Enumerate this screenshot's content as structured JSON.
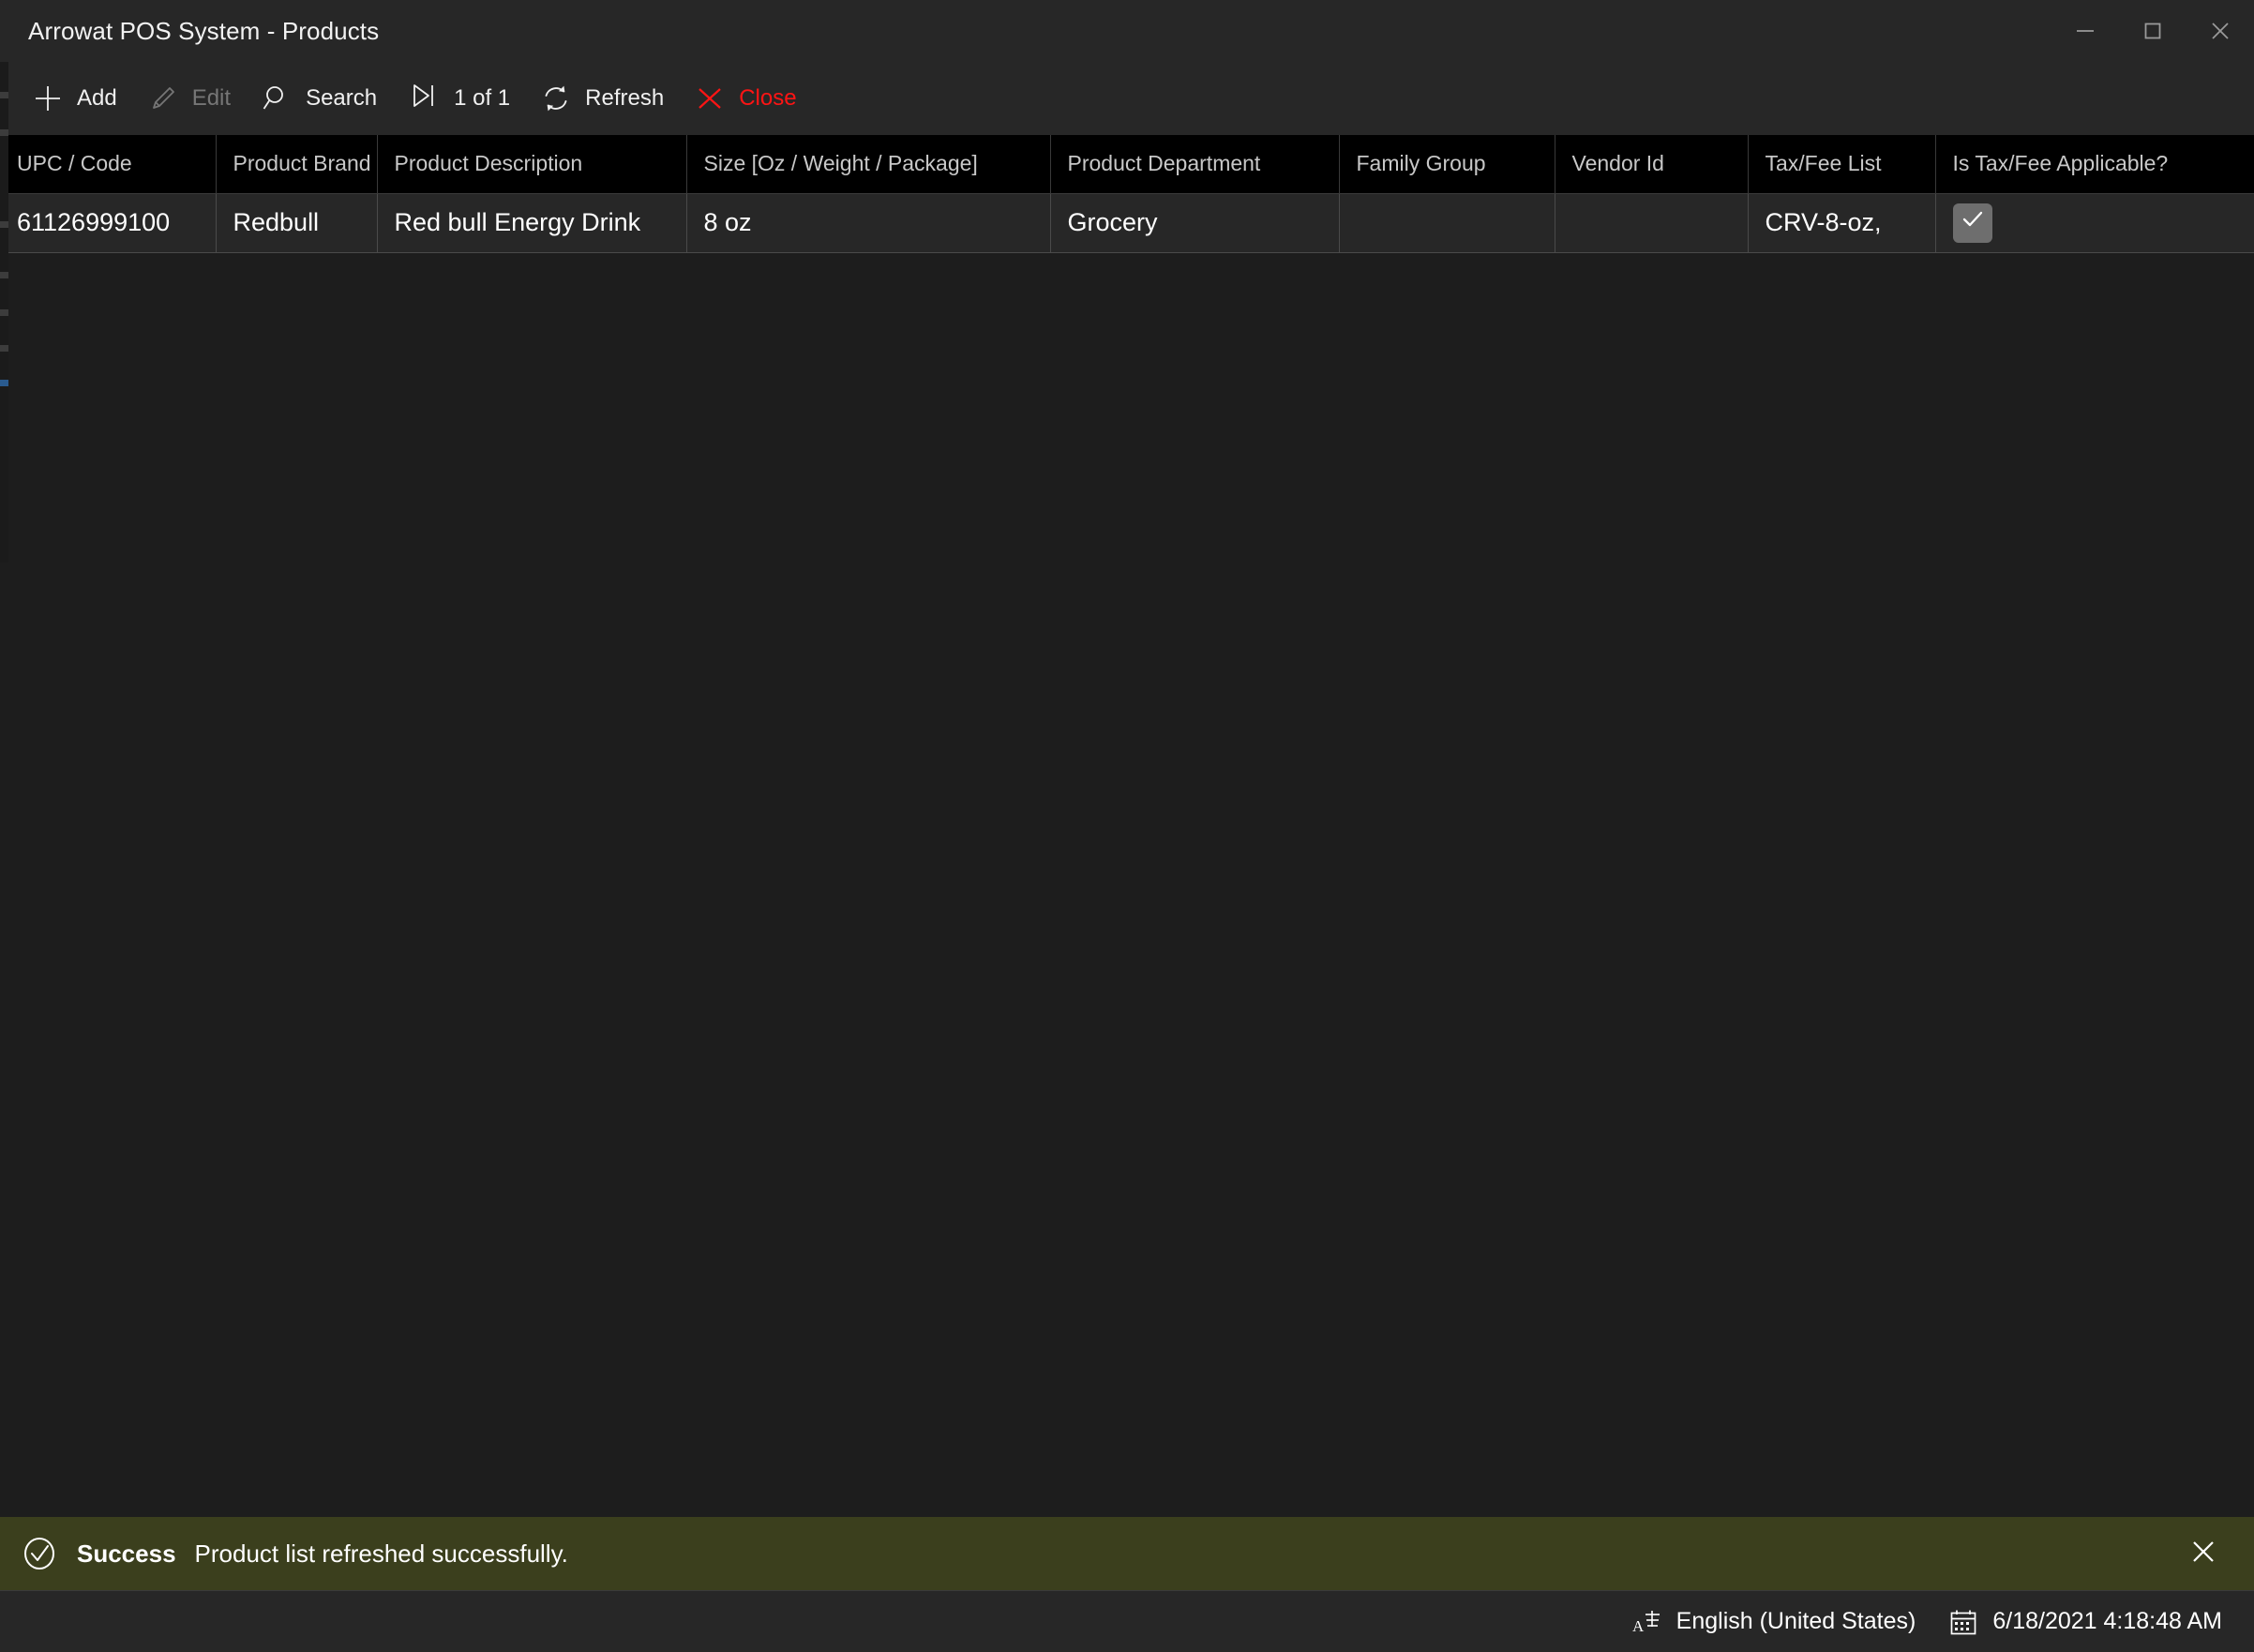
{
  "window": {
    "title": "Arrowat POS System - Products",
    "controls": [
      {
        "name": "minimize",
        "icon": "minimize-icon"
      },
      {
        "name": "maximize",
        "icon": "maximize-icon"
      },
      {
        "name": "close",
        "icon": "close-icon"
      }
    ]
  },
  "toolbar": {
    "add_label": "Add",
    "add_icon": "plus-icon",
    "edit_label": "Edit",
    "edit_icon": "pencil-icon",
    "edit_disabled": true,
    "search_label": "Search",
    "search_icon": "magnifier-icon",
    "pager_icon": "skip-to-end-icon",
    "pager_label": "1 of 1",
    "refresh_label": "Refresh",
    "refresh_icon": "refresh-circular-arrows-icon",
    "close_label": "Close",
    "close_icon": "x-icon",
    "close_color": "#ff1414"
  },
  "grid": {
    "columns": [
      "UPC / Code",
      "Product Brand",
      "Product Description",
      "Size [Oz / Weight / Package]",
      "Product Department",
      "Family Group",
      "Vendor Id",
      "Tax/Fee List",
      "Is Tax/Fee Applicable?"
    ],
    "rows": [
      {
        "upc": "61126999100",
        "brand": "Redbull",
        "description": "Red bull Energy Drink",
        "size": "8 oz",
        "department": "Grocery",
        "family_group": "",
        "vendor_id": "",
        "tax_fee_list": "CRV-8-oz,",
        "tax_applicable": true
      }
    ]
  },
  "notification": {
    "icon": "check-circle-icon",
    "title": "Success",
    "message": "Product list refreshed successfully.",
    "close_icon": "x-icon",
    "background": "#3b3f1d"
  },
  "statusbar": {
    "language_icon": "input-language-icon",
    "language": "English (United States)",
    "datetime_icon": "calendar-icon",
    "datetime": "6/18/2021 4:18:48 AM"
  }
}
